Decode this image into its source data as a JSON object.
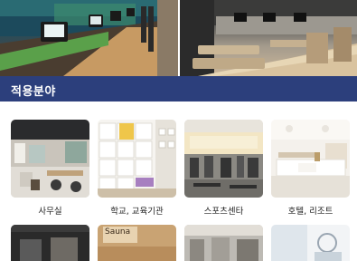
{
  "section": {
    "title": "적용분야"
  },
  "cards": [
    {
      "label": "사무실"
    },
    {
      "label": "학교, 교육기관"
    },
    {
      "label": "스포츠센타"
    },
    {
      "label": "호텔, 리조트"
    }
  ],
  "row2": {
    "sauna_sign": "Sauna"
  },
  "colors": {
    "section_bar": "#2c3f7c"
  }
}
